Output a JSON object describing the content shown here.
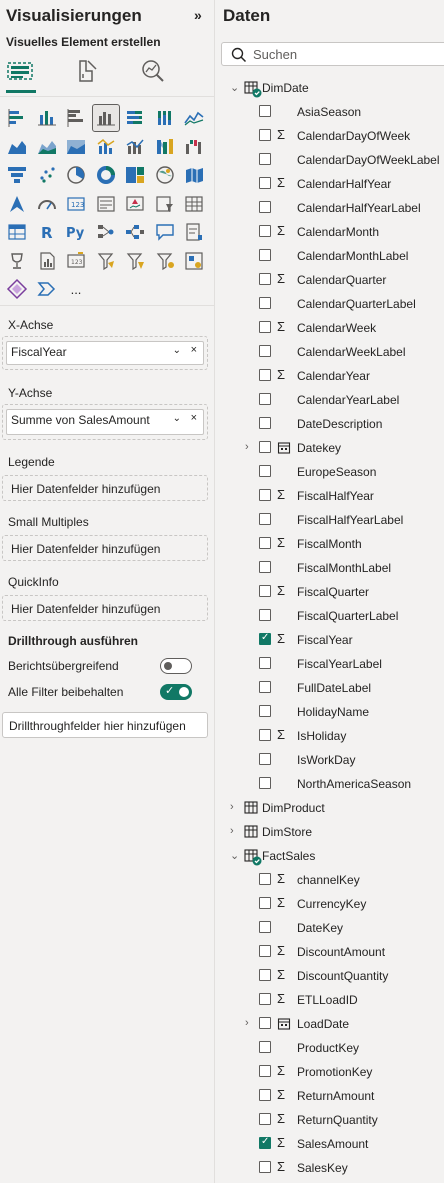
{
  "viz": {
    "title": "Visualisierungen",
    "collapse_icon": "»",
    "subtitle": "Visuelles Element erstellen",
    "modes": [
      "build-visual-icon",
      "format-visual-icon",
      "analytics-icon"
    ],
    "icon_overflow": "...",
    "wells": {
      "x_axis_label": "X-Achse",
      "x_axis_value": "FiscalYear",
      "y_axis_label": "Y-Achse",
      "y_axis_value": "Summe von SalesAmount",
      "legend_label": "Legende",
      "legend_placeholder": "Hier Datenfelder hinzufügen",
      "small_multiples_label": "Small Multiples",
      "small_multiples_placeholder": "Hier Datenfelder hinzufügen",
      "tooltip_label": "QuickInfo",
      "tooltip_placeholder": "Hier Datenfelder hinzufügen"
    },
    "drillthrough": {
      "heading": "Drillthrough ausführen",
      "cross_report_label": "Berichtsübergreifend",
      "cross_report_on": false,
      "keep_filters_label": "Alle Filter beibehalten",
      "keep_filters_on": true,
      "fields_placeholder": "Drillthroughfelder hier hinzufügen"
    }
  },
  "data": {
    "title": "Daten",
    "search_placeholder": "Suchen",
    "tables": {
      "dimdate": "DimDate",
      "dimproduct": "DimProduct",
      "dimstore": "DimStore",
      "factsales": "FactSales"
    },
    "dimdate_fields": [
      {
        "name": "AsiaSeason",
        "sigma": false,
        "checked": false
      },
      {
        "name": "CalendarDayOfWeek",
        "sigma": true,
        "checked": false
      },
      {
        "name": "CalendarDayOfWeekLabel",
        "sigma": false,
        "checked": false
      },
      {
        "name": "CalendarHalfYear",
        "sigma": true,
        "checked": false
      },
      {
        "name": "CalendarHalfYearLabel",
        "sigma": false,
        "checked": false
      },
      {
        "name": "CalendarMonth",
        "sigma": true,
        "checked": false
      },
      {
        "name": "CalendarMonthLabel",
        "sigma": false,
        "checked": false
      },
      {
        "name": "CalendarQuarter",
        "sigma": true,
        "checked": false
      },
      {
        "name": "CalendarQuarterLabel",
        "sigma": false,
        "checked": false
      },
      {
        "name": "CalendarWeek",
        "sigma": true,
        "checked": false
      },
      {
        "name": "CalendarWeekLabel",
        "sigma": false,
        "checked": false
      },
      {
        "name": "CalendarYear",
        "sigma": true,
        "checked": false
      },
      {
        "name": "CalendarYearLabel",
        "sigma": false,
        "checked": false
      },
      {
        "name": "DateDescription",
        "sigma": false,
        "checked": false
      },
      {
        "name": "Datekey",
        "sigma": false,
        "checked": false,
        "hierarchy": true
      },
      {
        "name": "EuropeSeason",
        "sigma": false,
        "checked": false
      },
      {
        "name": "FiscalHalfYear",
        "sigma": true,
        "checked": false
      },
      {
        "name": "FiscalHalfYearLabel",
        "sigma": false,
        "checked": false
      },
      {
        "name": "FiscalMonth",
        "sigma": true,
        "checked": false
      },
      {
        "name": "FiscalMonthLabel",
        "sigma": false,
        "checked": false
      },
      {
        "name": "FiscalQuarter",
        "sigma": true,
        "checked": false
      },
      {
        "name": "FiscalQuarterLabel",
        "sigma": false,
        "checked": false
      },
      {
        "name": "FiscalYear",
        "sigma": true,
        "checked": true
      },
      {
        "name": "FiscalYearLabel",
        "sigma": false,
        "checked": false
      },
      {
        "name": "FullDateLabel",
        "sigma": false,
        "checked": false
      },
      {
        "name": "HolidayName",
        "sigma": false,
        "checked": false
      },
      {
        "name": "IsHoliday",
        "sigma": true,
        "checked": false
      },
      {
        "name": "IsWorkDay",
        "sigma": false,
        "checked": false
      },
      {
        "name": "NorthAmericaSeason",
        "sigma": false,
        "checked": false
      }
    ],
    "factsales_fields": [
      {
        "name": "channelKey",
        "sigma": true,
        "checked": false
      },
      {
        "name": "CurrencyKey",
        "sigma": true,
        "checked": false
      },
      {
        "name": "DateKey",
        "sigma": false,
        "checked": false
      },
      {
        "name": "DiscountAmount",
        "sigma": true,
        "checked": false
      },
      {
        "name": "DiscountQuantity",
        "sigma": true,
        "checked": false
      },
      {
        "name": "ETLLoadID",
        "sigma": true,
        "checked": false
      },
      {
        "name": "LoadDate",
        "sigma": false,
        "checked": false,
        "hierarchy": true
      },
      {
        "name": "ProductKey",
        "sigma": false,
        "checked": false
      },
      {
        "name": "PromotionKey",
        "sigma": true,
        "checked": false
      },
      {
        "name": "ReturnAmount",
        "sigma": true,
        "checked": false
      },
      {
        "name": "ReturnQuantity",
        "sigma": true,
        "checked": false
      },
      {
        "name": "SalesAmount",
        "sigma": true,
        "checked": true
      },
      {
        "name": "SalesKey",
        "sigma": true,
        "checked": false
      }
    ]
  },
  "colors": {
    "accent": "#117865",
    "text": "#252423",
    "border": "#c8c6c4"
  }
}
